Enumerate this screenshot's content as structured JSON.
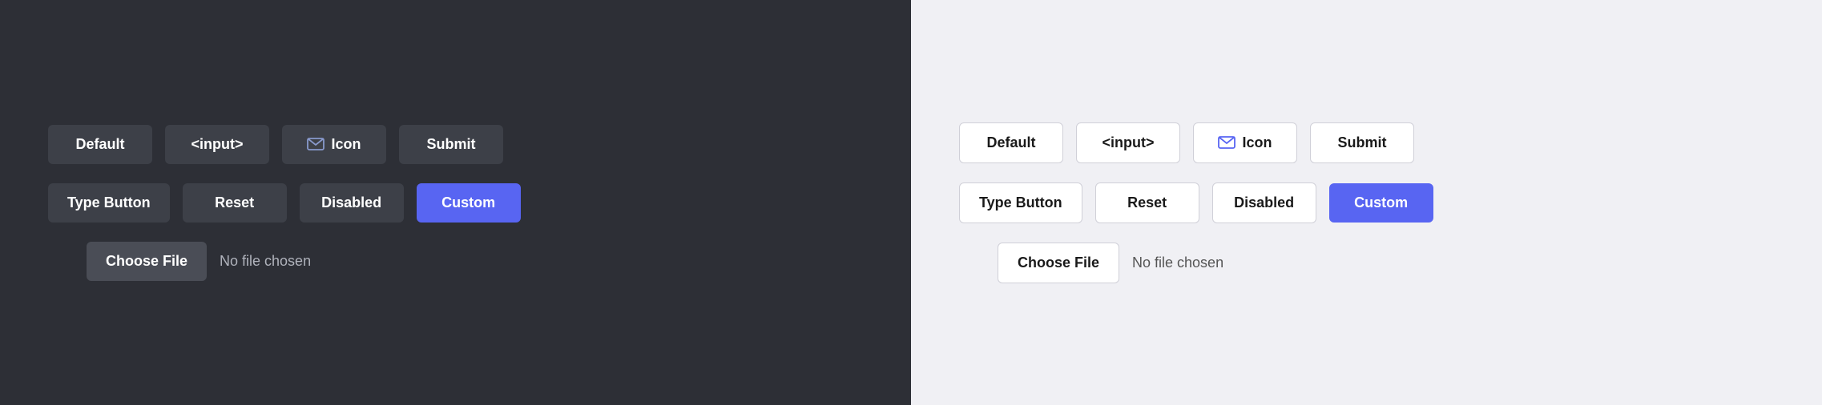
{
  "dark_panel": {
    "bg_color": "#2d2f36",
    "row1": {
      "buttons": [
        {
          "id": "default",
          "label": "Default",
          "type": "normal"
        },
        {
          "id": "input",
          "label": "<input>",
          "type": "normal"
        },
        {
          "id": "icon",
          "label": "Icon",
          "type": "icon"
        },
        {
          "id": "submit",
          "label": "Submit",
          "type": "normal"
        }
      ]
    },
    "row2": {
      "buttons": [
        {
          "id": "type-button",
          "label": "Type Button",
          "type": "normal"
        },
        {
          "id": "reset",
          "label": "Reset",
          "type": "normal"
        },
        {
          "id": "disabled",
          "label": "Disabled",
          "type": "normal"
        },
        {
          "id": "custom",
          "label": "Custom",
          "type": "custom"
        }
      ]
    },
    "file": {
      "choose_label": "Choose File",
      "no_file_text": "No file chosen"
    }
  },
  "light_panel": {
    "bg_color": "#f0f0f4",
    "row1": {
      "buttons": [
        {
          "id": "default",
          "label": "Default",
          "type": "normal"
        },
        {
          "id": "input",
          "label": "<input>",
          "type": "normal"
        },
        {
          "id": "icon",
          "label": "Icon",
          "type": "icon"
        },
        {
          "id": "submit",
          "label": "Submit",
          "type": "normal"
        }
      ]
    },
    "row2": {
      "buttons": [
        {
          "id": "type-button",
          "label": "Type Button",
          "type": "normal"
        },
        {
          "id": "reset",
          "label": "Reset",
          "type": "normal"
        },
        {
          "id": "disabled",
          "label": "Disabled",
          "type": "normal"
        },
        {
          "id": "custom",
          "label": "Custom",
          "type": "custom"
        }
      ]
    },
    "file": {
      "choose_label": "Choose File",
      "no_file_text": "No file chosen"
    }
  },
  "icon": {
    "mail": "✉"
  }
}
